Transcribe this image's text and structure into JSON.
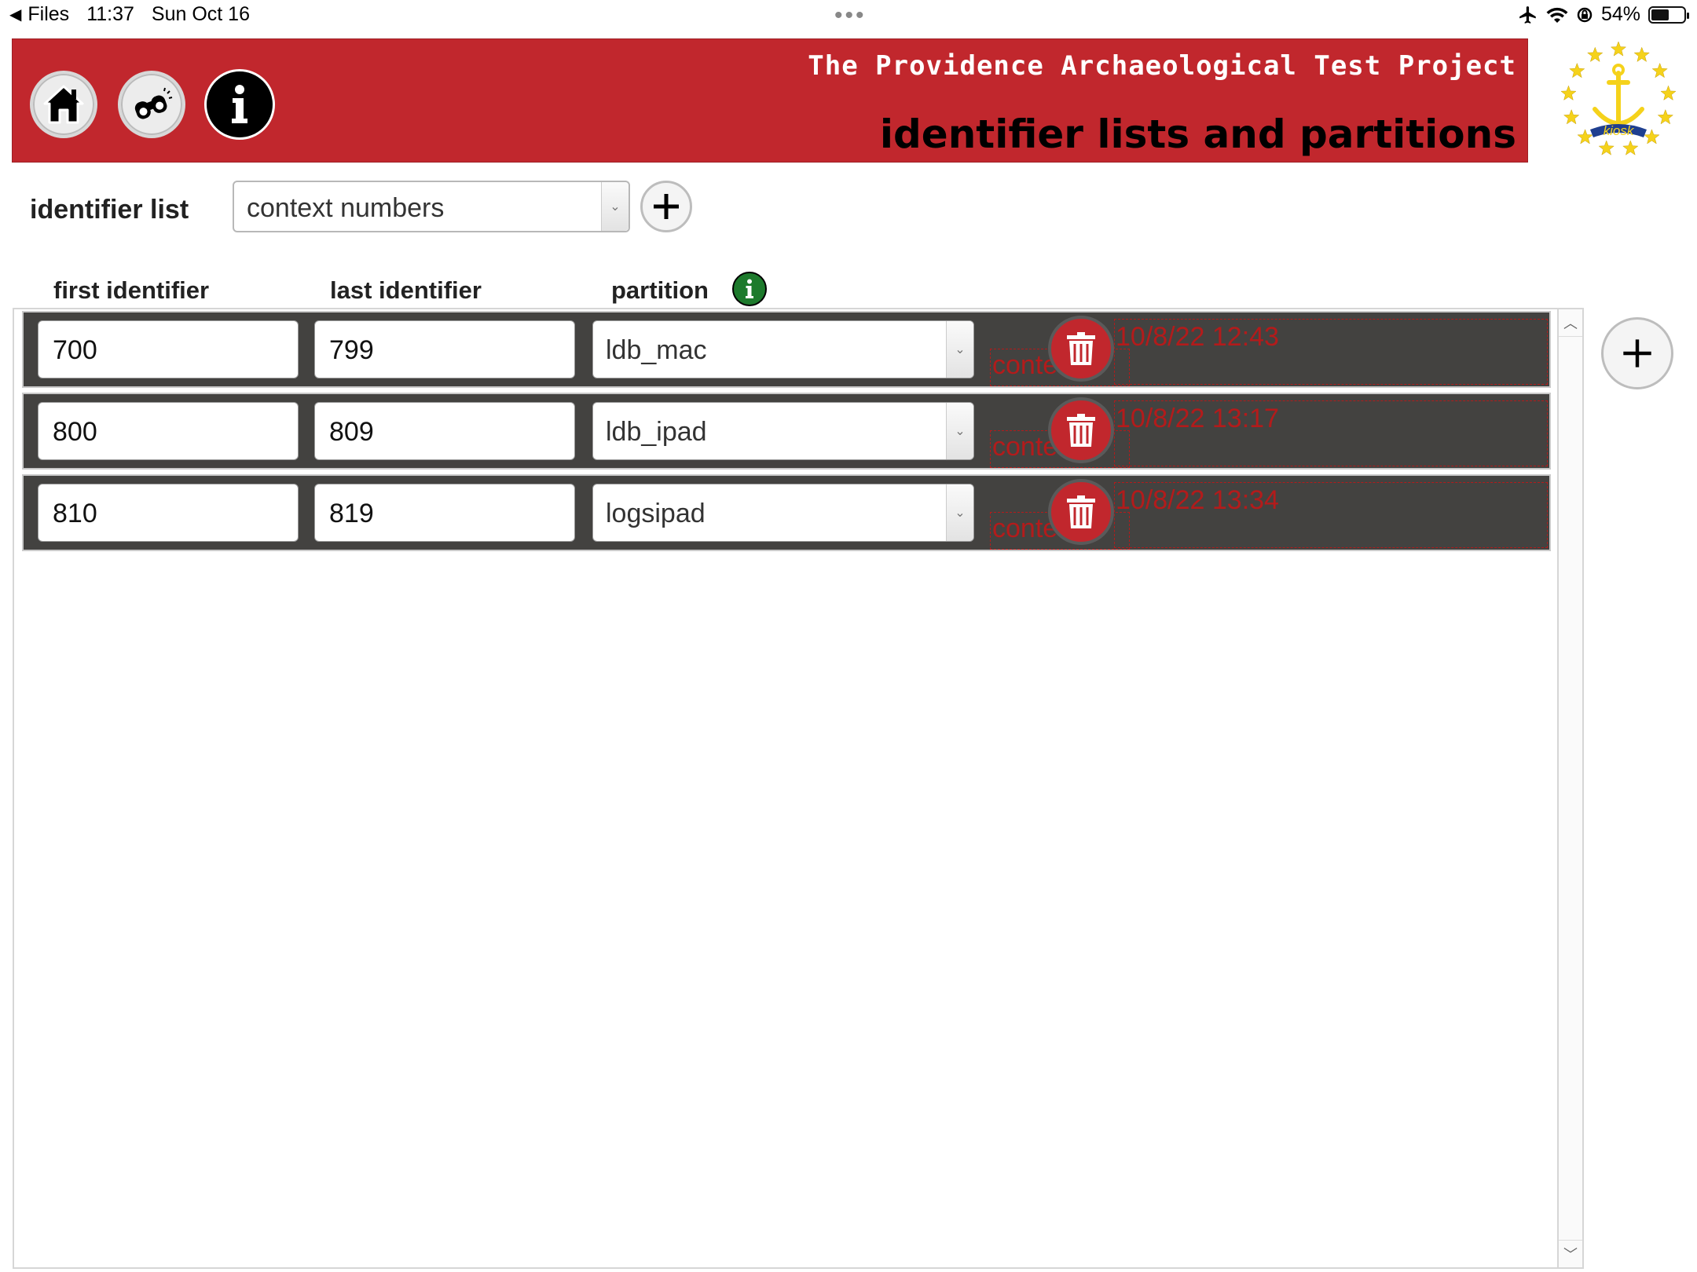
{
  "status_bar": {
    "back_label": "Files",
    "time": "11:37",
    "date": "Sun Oct 16",
    "battery": "54%",
    "battery_level": 0.54,
    "icons": [
      "airplane-icon",
      "wifi-icon",
      "orientation-lock-icon",
      "battery-icon"
    ]
  },
  "header": {
    "project_title": "The Providence Archaeological Test Project",
    "page_title": "identifier lists and partitions",
    "nav_icons": [
      "home-icon",
      "binoculars-icon",
      "info-icon"
    ],
    "logo_text": "kiosk",
    "colors": {
      "banner": "#c1272d",
      "logo_star": "#f5d21b",
      "logo_ribbon": "#1f3f8f"
    }
  },
  "identifier_list": {
    "label": "identifier list",
    "selected": "context numbers"
  },
  "columns": {
    "first": "first identifier",
    "last": "last identifier",
    "partition": "partition"
  },
  "rows": [
    {
      "first": "700",
      "last": "799",
      "partition": "ldb_mac",
      "ghost_text": "conte",
      "timestamp": "10/8/22 12:43"
    },
    {
      "first": "800",
      "last": "809",
      "partition": "ldb_ipad",
      "ghost_text": "conte",
      "timestamp": "10/8/22 13:17"
    },
    {
      "first": "810",
      "last": "819",
      "partition": "logsipad",
      "ghost_text": "conte",
      "timestamp": "10/8/22 13:34"
    }
  ]
}
